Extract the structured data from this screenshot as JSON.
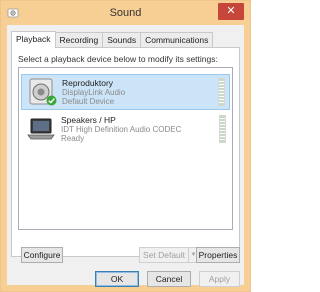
{
  "window": {
    "title": "Sound",
    "close_glyph": "✕"
  },
  "tabs": [
    {
      "label": "Playback",
      "active": true
    },
    {
      "label": "Recording",
      "active": false
    },
    {
      "label": "Sounds",
      "active": false
    },
    {
      "label": "Communications",
      "active": false
    }
  ],
  "instruction": "Select a playback device below to modify its settings:",
  "devices": [
    {
      "name": "Reproduktory",
      "line1": "DisplayLink Audio",
      "line2": "Default Device",
      "icon": "speaker-icon",
      "status_icon": "default-check-icon",
      "selected": true
    },
    {
      "name": "Speakers / HP",
      "line1": "IDT High Definition Audio CODEC",
      "line2": "Ready",
      "icon": "laptop-speaker-icon",
      "selected": false
    }
  ],
  "buttons": {
    "configure": "Configure",
    "set_default": "Set Default",
    "properties": "Properties",
    "ok": "OK",
    "cancel": "Cancel",
    "apply": "Apply"
  },
  "colors": {
    "titlebar": "#f7ce93",
    "selection": "#cce4f7",
    "close": "#c7463a",
    "check": "#3aa63a"
  }
}
